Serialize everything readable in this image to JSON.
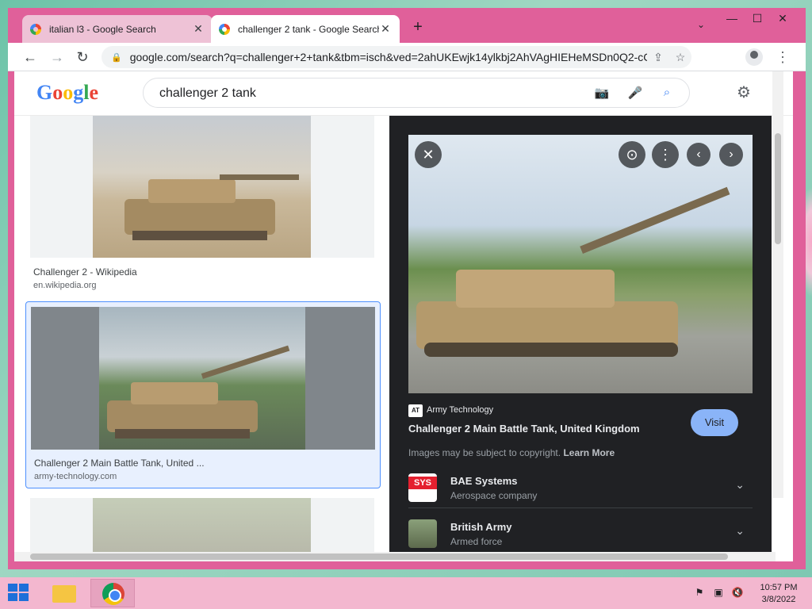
{
  "browser": {
    "tabs": [
      {
        "title": "italian l3 - Google Search",
        "active": false
      },
      {
        "title": "challenger 2 tank - Google Search",
        "active": true
      }
    ],
    "url": "google.com/search?q=challenger+2+tank&tbm=isch&ved=2ahUKEwjk14ylkbj2AhVAgHIEHeMSDn0Q2-cCegQI...",
    "new_tab_symbol": "+",
    "minimize": "—",
    "maximize": "☐",
    "close": "✕"
  },
  "google": {
    "logo_letters": [
      "G",
      "o",
      "o",
      "g",
      "l",
      "e"
    ],
    "logo_colors": [
      "#4285f4",
      "#ea4335",
      "#fbbc05",
      "#4285f4",
      "#34a853",
      "#ea4335"
    ],
    "query": "challenger 2 tank"
  },
  "results": [
    {
      "caption": "Challenger 2 - Wikipedia",
      "source": "en.wikipedia.org"
    },
    {
      "caption": "Challenger 2 Main Battle Tank, United ...",
      "source": "army-technology.com"
    }
  ],
  "preview": {
    "source_badge": "AT",
    "source_name": "Army Technology",
    "title": "Challenger 2 Main Battle Tank, United Kingdom",
    "visit_label": "Visit",
    "copyright_text": "Images may be subject to copyright.",
    "learn_more": "Learn More",
    "entities": [
      {
        "name": "BAE Systems",
        "desc": "Aerospace company",
        "logo_text": "SYS"
      },
      {
        "name": "British Army",
        "desc": "Armed force"
      }
    ]
  },
  "taskbar": {
    "time": "10:57 PM",
    "date": "3/8/2022"
  },
  "colors": {
    "window_frame": "#e0609a",
    "accent_blue": "#8ab4f8",
    "preview_bg": "#202124"
  }
}
